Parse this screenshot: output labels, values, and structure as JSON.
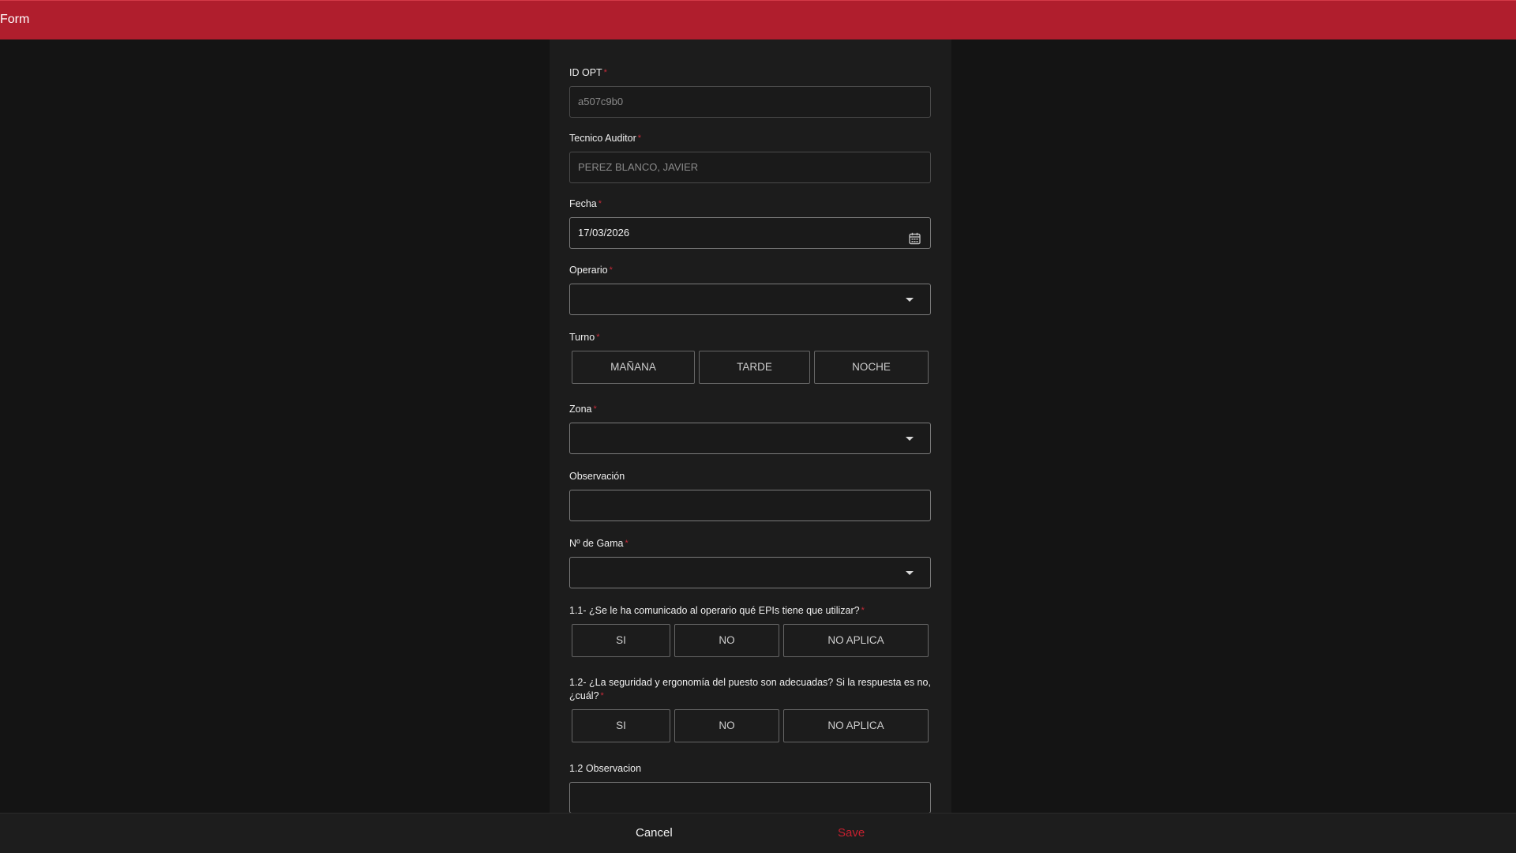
{
  "header": {
    "title": "Form"
  },
  "form": {
    "id_opt": {
      "label": "ID OPT",
      "required": "*",
      "value": "a507c9b0"
    },
    "tecnico": {
      "label": "Tecnico Auditor",
      "required": "*",
      "value": "PEREZ BLANCO, JAVIER"
    },
    "fecha": {
      "label": "Fecha",
      "required": "*",
      "value": "17/03/2026",
      "icon": "calendar-icon"
    },
    "operario": {
      "label": "Operario",
      "required": "*",
      "value": ""
    },
    "turno": {
      "label": "Turno",
      "required": "*",
      "options": [
        "MAÑANA",
        "TARDE",
        "NOCHE"
      ]
    },
    "zona": {
      "label": "Zona",
      "required": "*",
      "value": ""
    },
    "observacion": {
      "label": "Observación",
      "value": ""
    },
    "gama": {
      "label": "Nº de Gama",
      "required": "*",
      "value": ""
    },
    "q1_1": {
      "label": "1.1- ¿Se le ha comunicado al operario qué EPIs tiene que utilizar?",
      "required": "*",
      "options": [
        "SI",
        "NO",
        "NO APLICA"
      ]
    },
    "q1_2": {
      "label": "1.2- ¿La seguridad y ergonomía del puesto son adecuadas? Si la respuesta es no, ¿cuál?",
      "required": "*",
      "options": [
        "SI",
        "NO",
        "NO APLICA"
      ]
    },
    "obs1_2": {
      "label": "1.2 Observacion",
      "value": ""
    }
  },
  "footer": {
    "cancel_label": "Cancel",
    "save_label": "Save"
  },
  "colors": {
    "brand": "#b01e2d",
    "save": "#c6202f",
    "background": "#141414",
    "panel": "#1c1c1c"
  }
}
